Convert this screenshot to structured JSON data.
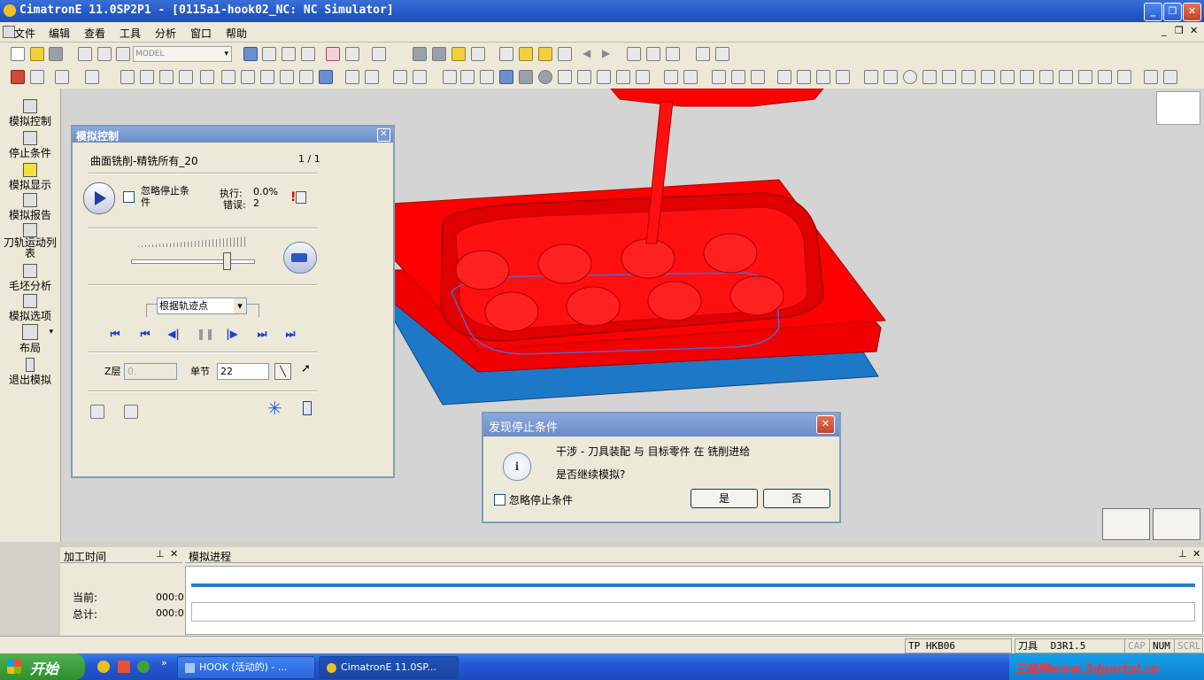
{
  "window": {
    "title": "CimatronE 11.0SP2P1 - [0115a1-hook02_NC: NC Simulator]"
  },
  "menu": [
    "文件",
    "编辑",
    "查看",
    "工具",
    "分析",
    "窗口",
    "帮助"
  ],
  "toolbar": {
    "model_combo": "MODEL"
  },
  "left_panel": [
    "模拟控制",
    "停止条件",
    "模拟显示",
    "模拟报告",
    "刀轨运动列表",
    "毛坯分析",
    "模拟选项",
    "布局",
    "退出模拟"
  ],
  "sim_control": {
    "title": "模拟控制",
    "operation": "曲面铣削-精铣所有_20",
    "page": "1 / 1",
    "ignore_stop_label": "忽略停止条件",
    "exec_label": "执行:",
    "exec_value": "0.0%",
    "error_label": "错误:",
    "error_value": "2",
    "step_mode": "根据轨迹点",
    "z_label": "Z层",
    "z_value": "0.",
    "step_label": "单节",
    "step_value": "22"
  },
  "stop_dialog": {
    "title": "发现停止条件",
    "message": "干涉 - 刀具装配 与 目标零件 在 铣削进给",
    "question": "是否继续模拟?",
    "ignore_label": "忽略停止条件",
    "yes": "是",
    "no": "否"
  },
  "bottom": {
    "time_panel_title": "加工时间",
    "progress_panel_title": "模拟进程",
    "current_label": "当前:",
    "current_value": "000:0",
    "total_label": "总计:",
    "total_value": "000:0",
    "progress_fraction": 1.0
  },
  "status": {
    "tp": "TP  HKB06",
    "tool_label": "刀具",
    "tool_value": "D3R1.5",
    "cap": "CAP",
    "num": "NUM",
    "scrl": "SCRL"
  },
  "taskbar": {
    "start": "开始",
    "task1": "HOOK (活动的) - ...",
    "task2": "CimatronE 11.0SP...",
    "watermark": "三维网www.3dportal.cn"
  },
  "colors": {
    "part_red": "#ff0000",
    "base_blue": "#1e78c8",
    "title_blue": "#2458c8"
  }
}
